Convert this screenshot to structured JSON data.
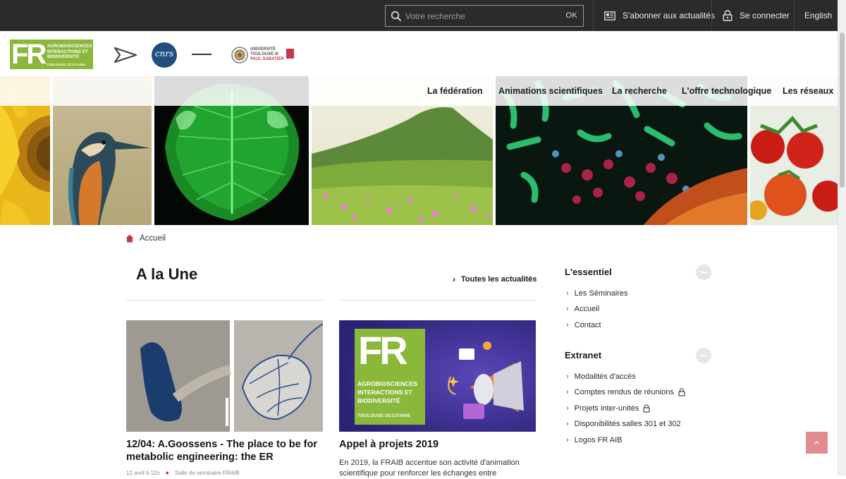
{
  "topbar": {
    "search_placeholder": "Votre recherche",
    "search_ok": "OK",
    "subscribe_label": "S'abonner aux actualités",
    "login_label": "Se connecter",
    "language_label": "English"
  },
  "logos": {
    "fr_letters": "FR",
    "fr_lines": [
      "AGROBIOSCIENCES",
      "INTERACTIONS ET",
      "BIODIVERSITÉ"
    ],
    "fr_sub": "TOULOUSE OCCITANIE",
    "cnrs": "cnrs",
    "ut3_line1": "UNIVERSITÉ",
    "ut3_line2": "TOULOUSE III",
    "ut3_line3": "PAUL SABATIER"
  },
  "nav": {
    "items": [
      "La fédération",
      "Animations scientifiques",
      "La recherche",
      "L'offre technologique",
      "Les réseaux"
    ]
  },
  "breadcrumb": {
    "home_label": "Accueil"
  },
  "news": {
    "section_title": "A la Une",
    "all_news_label": "Toutes les actualités",
    "cards": [
      {
        "title": "12/04: A.Goossens - The place to be for metabolic engineering: the ER",
        "date": "12 avril à 11h",
        "place": "Salle de séminaire FRAIB"
      },
      {
        "title": "Appel à projets 2019",
        "excerpt": "En 2019, la FRAIB accentue son activité d'animation scientifique pour renforcer les échanges entre"
      }
    ],
    "poster": {
      "fr_letters": "FR",
      "lines": [
        "AGROBIOSCIENCES",
        "INTERACTIONS ET",
        "BIODIVERSITÉ"
      ],
      "sub": "TOULOUSE OCCITANIE"
    }
  },
  "sidebar": {
    "essentiel_title": "L'essentiel",
    "essentiel_items": [
      "Les Séminaires",
      "Accueil",
      "Contact"
    ],
    "extranet_title": "Extranet",
    "extranet_items": [
      {
        "label": "Modalités d'accès",
        "locked": false
      },
      {
        "label": "Comptes rendus de réunions",
        "locked": true
      },
      {
        "label": "Projets inter-unités",
        "locked": true
      },
      {
        "label": "Disponibilités salles 301 et 302",
        "locked": false
      },
      {
        "label": "Logos FR AIB",
        "locked": false
      }
    ]
  },
  "colors": {
    "topbar": "#2b2b2b",
    "brand_green": "#8ab83a",
    "accent_red": "#c7374a",
    "to_top": "#e08c90",
    "poster_bg": "#3b2f8f"
  },
  "icons": [
    "search-icon",
    "newsletter-icon",
    "lock-icon",
    "home-icon",
    "chevron-right-icon",
    "arrow-up-icon",
    "send-arrow-icon"
  ]
}
